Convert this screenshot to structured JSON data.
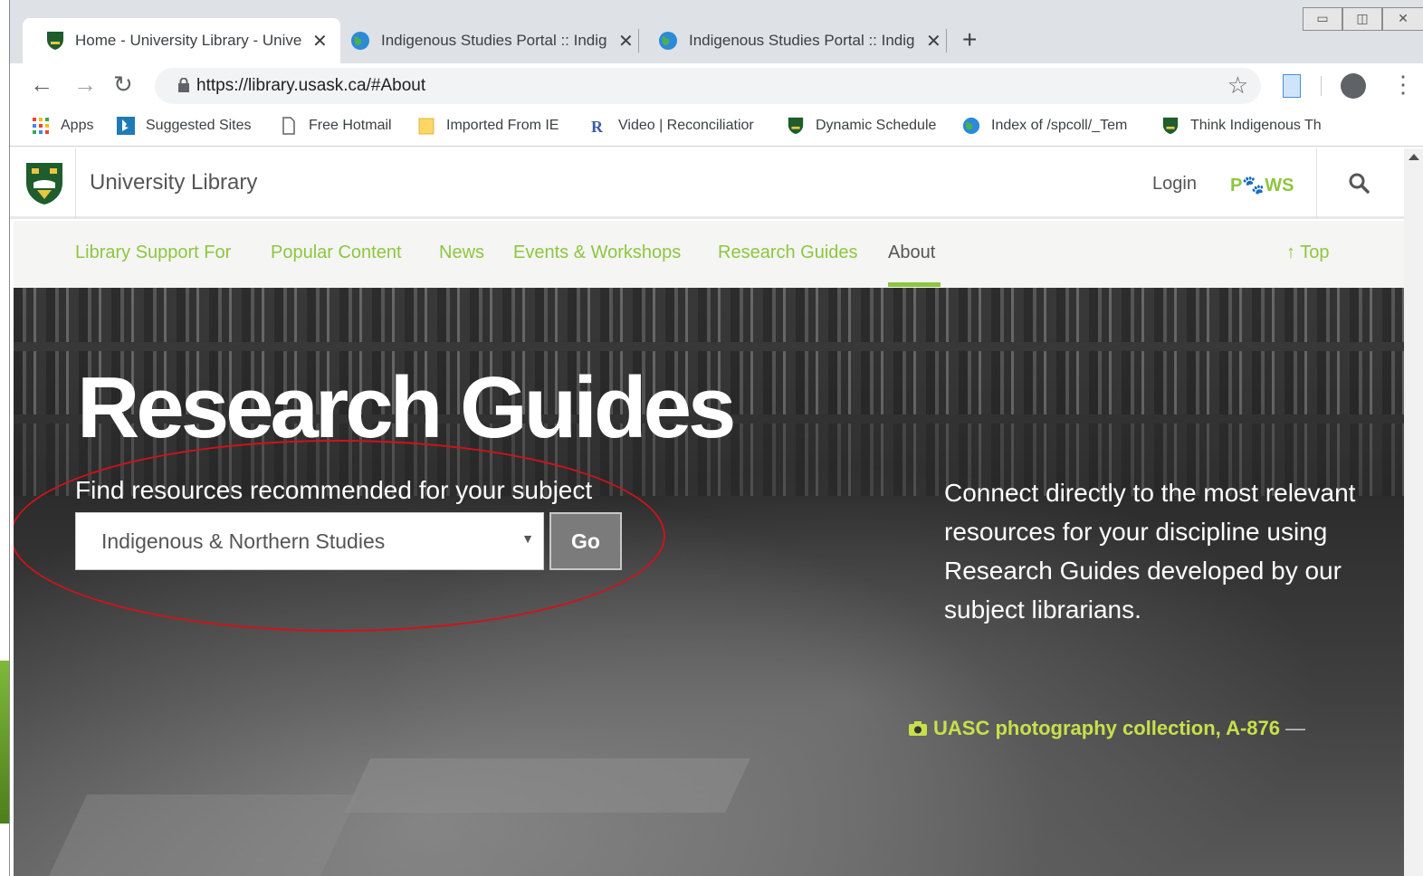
{
  "browser": {
    "tabs": [
      {
        "title": "Home - University Library - Unive",
        "close": "✕"
      },
      {
        "title": "Indigenous Studies Portal :: Indig",
        "close": "✕"
      },
      {
        "title": "Indigenous Studies Portal :: Indig",
        "close": "✕"
      }
    ],
    "new_tab": "+",
    "url": "https://library.usask.ca/#About",
    "nav": {
      "back": "←",
      "forward": "→",
      "reload": "↻"
    },
    "star": "☆",
    "menu": "⋮",
    "bookmarks": [
      {
        "label": "Apps",
        "icon": "apps-grid-icon"
      },
      {
        "label": "Suggested Sites",
        "icon": "bing-icon"
      },
      {
        "label": "Free Hotmail",
        "icon": "page-icon"
      },
      {
        "label": "Imported From IE",
        "icon": "folder-icon"
      },
      {
        "label": "Video | Reconciliatior",
        "icon": "reconciliation-r-icon"
      },
      {
        "label": "Dynamic Schedule",
        "icon": "usask-shield-icon"
      },
      {
        "label": "Index of /spcoll/_Tem",
        "icon": "globe-icon"
      },
      {
        "label": "Think Indigenous Th",
        "icon": "usask-shield-icon"
      }
    ]
  },
  "site": {
    "title": "University Library",
    "login": "Login",
    "paws": "P🐾WS",
    "nav": [
      {
        "label": "Library Support For"
      },
      {
        "label": "Popular Content"
      },
      {
        "label": "News"
      },
      {
        "label": "Events & Workshops"
      },
      {
        "label": "Research Guides"
      },
      {
        "label": "About"
      }
    ],
    "top_link": "↑ Top"
  },
  "hero": {
    "title": "Research Guides",
    "subtitle": "Find resources recommended for your subject",
    "select_value": "Indigenous & Northern Studies",
    "select_arrow": "▼",
    "go": "Go",
    "description": "Connect directly to the most relevant resources for your discipline using Research Guides developed by our subject librarians.",
    "credit": "UASC photography collection, A-876",
    "credit_dash": "—"
  },
  "colors": {
    "accent": "#8dc63f",
    "highlight": "#d0121b",
    "credit": "#c8e04a"
  }
}
